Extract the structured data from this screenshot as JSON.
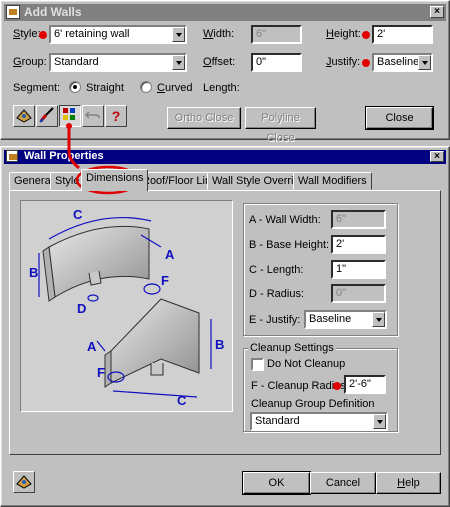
{
  "add_walls": {
    "title": "Add Walls",
    "style_label": "Style:",
    "style_value": "6' retaining wall",
    "group_label": "Group:",
    "group_value": "Standard",
    "segment_label": "Segment:",
    "straight_label": "Straight",
    "curved_label": "Curved",
    "width_label": "Width:",
    "width_value": "6\"",
    "offset_label": "Offset:",
    "offset_value": "0\"",
    "length_label": "Length:",
    "height_label": "Height:",
    "height_value": "2'",
    "justify_label": "Justify:",
    "justify_value": "Baseline",
    "ortho_close": "Ortho Close",
    "polyline_close": "Polyline Close",
    "close": "Close",
    "help_glyph": "?"
  },
  "wall_props": {
    "title": "Wall Properties",
    "tabs": [
      "General",
      "Style",
      "Dimensions",
      "Roof/Floor Line",
      "Wall Style Overrides",
      "Wall Modifiers"
    ],
    "a_label": "A - Wall Width:",
    "a_value": "6\"",
    "b_label": "B - Base Height:",
    "b_value": "2'",
    "c_label": "C - Length:",
    "c_value": "1\"",
    "d_label": "D - Radius:",
    "d_value": "0\"",
    "e_label": "E - Justify:",
    "e_value": "Baseline",
    "cleanup_title": "Cleanup Settings",
    "do_not_cleanup": "Do Not Cleanup",
    "f_label": "F - Cleanup Radius:",
    "f_value": "2'-6\"",
    "cleanup_group_label": "Cleanup Group Definition",
    "cleanup_group_value": "Standard",
    "ok": "OK",
    "cancel": "Cancel",
    "help": "Help",
    "diagram_letters": [
      "A",
      "B",
      "C",
      "D",
      "F"
    ]
  },
  "colors": {
    "title_active": "#000080",
    "title_inactive": "#808080",
    "highlight": "#e00000",
    "dimension": "#1010c0"
  }
}
